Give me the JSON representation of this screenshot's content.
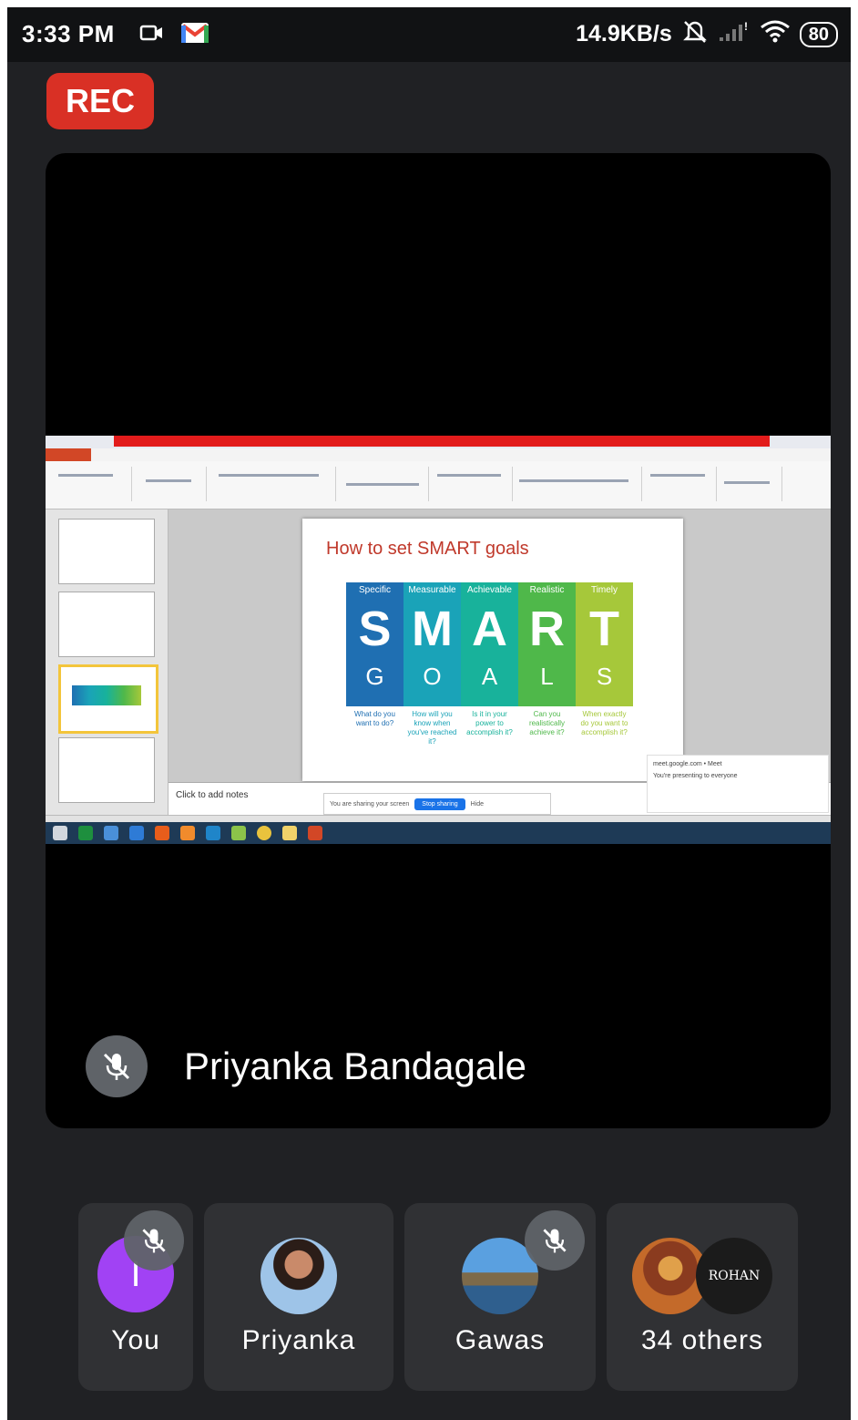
{
  "status_bar": {
    "time": "3:33 PM",
    "net_speed": "14.9KB/s",
    "battery": "80",
    "icons": [
      "video-icon",
      "gmail-icon",
      "alarm-off-icon",
      "signal-icon",
      "wifi-icon",
      "battery-icon"
    ]
  },
  "rec_badge": "REC",
  "presenter": {
    "name": "Priyanka Bandagale",
    "muted": true
  },
  "shared_screen": {
    "slide_title": "How to set SMART goals",
    "columns": [
      {
        "header": "Specific",
        "letter": "S",
        "sub": "G",
        "caption": "What do you want to do?",
        "color": "#1f6fb2"
      },
      {
        "header": "Measurable",
        "letter": "M",
        "sub": "O",
        "caption": "How will you know when you've reached it?",
        "color": "#1aa3b8"
      },
      {
        "header": "Achievable",
        "letter": "A",
        "sub": "A",
        "caption": "Is it in your power to accomplish it?",
        "color": "#18b29b"
      },
      {
        "header": "Realistic",
        "letter": "R",
        "sub": "L",
        "caption": "Can you realistically achieve it?",
        "color": "#4fb84a"
      },
      {
        "header": "Timely",
        "letter": "T",
        "sub": "S",
        "caption": "When exactly do you want to accomplish it?",
        "color": "#a6c83a"
      }
    ],
    "notes_placeholder": "Click to add notes",
    "share_bar_text": "You are sharing your screen",
    "stop_sharing_label": "Stop sharing",
    "hide_label": "Hide",
    "popup_line1": "meet.google.com • Meet",
    "popup_line2": "You're presenting to everyone"
  },
  "participants": [
    {
      "label": "You",
      "avatar_letter": "I",
      "avatar_color": "#a142f4",
      "muted": true
    },
    {
      "label": "Priyanka",
      "muted": false
    },
    {
      "label": "Gawas",
      "muted": true
    },
    {
      "label": "34 others",
      "avatar_text": "ROHAN",
      "muted": false
    }
  ]
}
